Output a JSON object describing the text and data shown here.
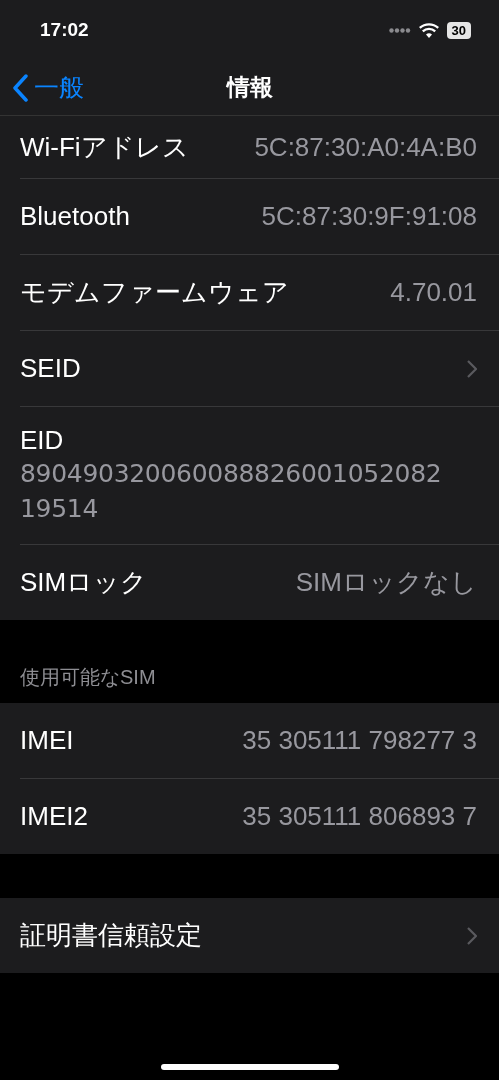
{
  "status_bar": {
    "time": "17:02",
    "battery": "30"
  },
  "nav": {
    "back": "一般",
    "title": "情報"
  },
  "groups": [
    {
      "rows": [
        {
          "kind": "value",
          "label": "Wi-Fiアドレス",
          "value": "5C:87:30:A0:4A:B0"
        },
        {
          "kind": "value",
          "label": "Bluetooth",
          "value": "5C:87:30:9F:91:08"
        },
        {
          "kind": "value",
          "label": "モデムファームウェア",
          "value": "4.70.01"
        },
        {
          "kind": "link",
          "label": "SEID"
        },
        {
          "kind": "stacked",
          "label": "EID",
          "value": "89049032006008882600105208219514"
        },
        {
          "kind": "value",
          "label": "SIMロック",
          "value": "SIMロックなし"
        }
      ]
    },
    {
      "header": "使用可能なSIM",
      "rows": [
        {
          "kind": "value",
          "label": "IMEI",
          "value": "35 305111 798277 3"
        },
        {
          "kind": "value",
          "label": "IMEI2",
          "value": "35 305111 806893 7"
        }
      ]
    },
    {
      "rows": [
        {
          "kind": "link",
          "label": "証明書信頼設定"
        }
      ]
    }
  ]
}
